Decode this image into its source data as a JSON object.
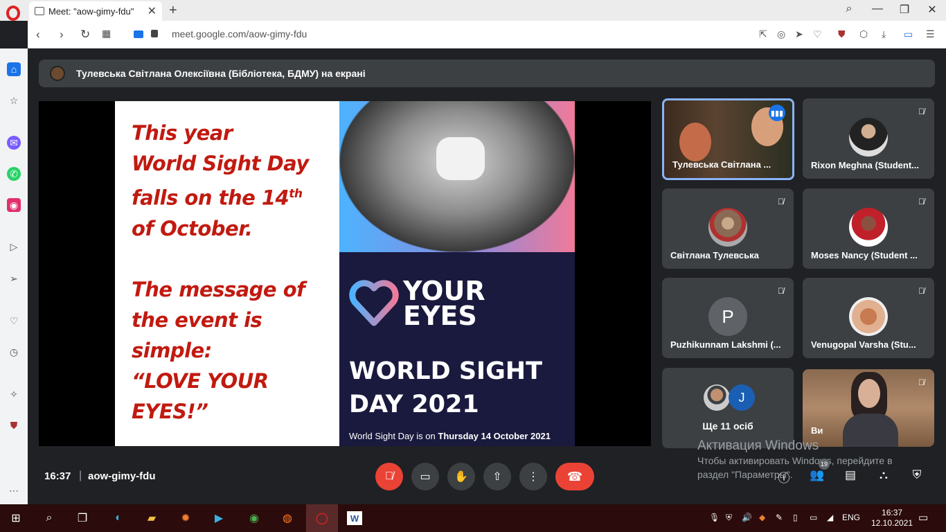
{
  "browser": {
    "tab_title": "Meet: \"aow-gimy-fdu\"",
    "tab_close": "✕",
    "new_tab": "+",
    "url": "meet.google.com/aow-gimy-fdu"
  },
  "presentation_banner": "Тулевська Світлана Олексіївна (Бібліотека, БДМУ) на екрані",
  "slide": {
    "left_lines": [
      "This year",
      "World Sight Day",
      "falls on the 14",
      "of October."
    ],
    "superscript": "th",
    "message_lines": [
      "The message of",
      "the event is",
      "simple:",
      "“LOVE YOUR",
      "EYES!”"
    ],
    "your_eyes": [
      "YOUR",
      "EYES"
    ],
    "title_lines": [
      "WORLD SIGHT",
      "DAY 2021"
    ],
    "subtitle_prefix": "World Sight Day is on ",
    "subtitle_bold": "Thursday 14 October 2021"
  },
  "participants": [
    {
      "name": "Тулевська Світлана ..."
    },
    {
      "name": "Rixon Meghna (Student..."
    },
    {
      "name": "Світлана Тулевська"
    },
    {
      "name": "Moses Nancy (Student ..."
    },
    {
      "name": "Puzhikunnam Lakshmi (..."
    },
    {
      "name": "Venugopal Varsha (Stu..."
    },
    {
      "name": "Ще 11 осіб"
    },
    {
      "name": "Ви"
    }
  ],
  "avatar_letters": {
    "p": "P",
    "j": "J"
  },
  "meeting": {
    "time": "16:37",
    "separator": "|",
    "code": "aow-gimy-fdu",
    "participant_count": "19"
  },
  "watermark": {
    "line1": "Активация Windows",
    "line2": "Чтобы активировать Windows, перейдите в",
    "line3": "раздел \"Параметры\"."
  },
  "taskbar": {
    "lang": "ENG",
    "clock_time": "16:37",
    "clock_date": "12.10.2021"
  },
  "colors": {
    "accent": "#1a73e8",
    "danger": "#ea4335",
    "slide_red": "#c11a10"
  }
}
